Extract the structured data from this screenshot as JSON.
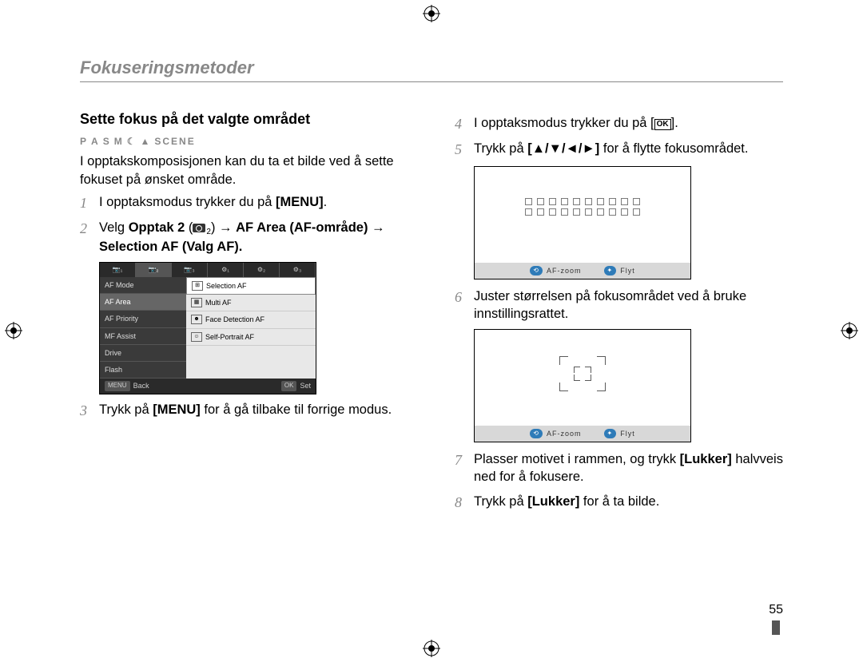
{
  "header": {
    "title": "Fokuseringsmetoder"
  },
  "left": {
    "heading": "Sette fokus på det valgte området",
    "modes": {
      "p": "P",
      "a": "A",
      "s": "S",
      "m": "M",
      "scene": "SCENE"
    },
    "intro": "I opptakskomposisjonen kan du ta et bilde ved å sette fokuset på ønsket område.",
    "steps": [
      {
        "n": "1",
        "pre": "I opptaksmodus trykker du på ",
        "bold1": "[MENU]",
        "post": "."
      },
      {
        "n": "2",
        "pre": "Velg ",
        "bold1": "Opptak 2",
        "mid1": " (",
        "cam_sub": "2",
        "mid2": ")  → ",
        "bold2": "AF Area (AF-område) → Selection AF (Valg AF).",
        "post": ""
      },
      {
        "n": "3",
        "pre": "Trykk på ",
        "bold1": "[MENU]",
        "post": " for å gå tilbake til forrige modus."
      }
    ],
    "menu": {
      "tabs": [
        "📷₁",
        "📷₂",
        "📷₃",
        "⚙₁",
        "⚙₂",
        "⚙₃"
      ],
      "active_tab_index": 1,
      "left_items": [
        "AF Mode",
        "AF Area",
        "AF Priority",
        "MF Assist",
        "Drive",
        "Flash"
      ],
      "left_selected_index": 1,
      "right_items": [
        {
          "icon": "⊞",
          "label": "Selection AF"
        },
        {
          "icon": "▦",
          "label": "Multi AF"
        },
        {
          "icon": "☻",
          "label": "Face Detection AF"
        },
        {
          "icon": "☺",
          "label": "Self-Portrait AF"
        }
      ],
      "right_selected_index": 0,
      "footer_left_btn": "MENU",
      "footer_left_label": "Back",
      "footer_right_btn": "OK",
      "footer_right_label": "Set"
    }
  },
  "right": {
    "steps": [
      {
        "n": "4",
        "pre": "I opptaksmodus trykker du på [",
        "ok": "OK",
        "post": "]."
      },
      {
        "n": "5",
        "pre": "Trykk på ",
        "bold1": "[▲/▼/◄/►]",
        "post": " for å flytte fokusområdet."
      },
      {
        "n": "6",
        "text": "Juster størrelsen på fokusområdet ved å bruke innstillingsrattet."
      },
      {
        "n": "7",
        "pre": "Plasser motivet i rammen, og trykk ",
        "bold1": "[Lukker]",
        "post": " halvveis ned for å fokusere."
      },
      {
        "n": "8",
        "pre": "Trykk på ",
        "bold1": "[Lukker]",
        "post": " for å ta bilde."
      }
    ],
    "preview_bar": {
      "chip1": "⟲",
      "label1": "AF-zoom",
      "chip2": "✦",
      "label2": "Flyt"
    }
  },
  "page_number": "55"
}
